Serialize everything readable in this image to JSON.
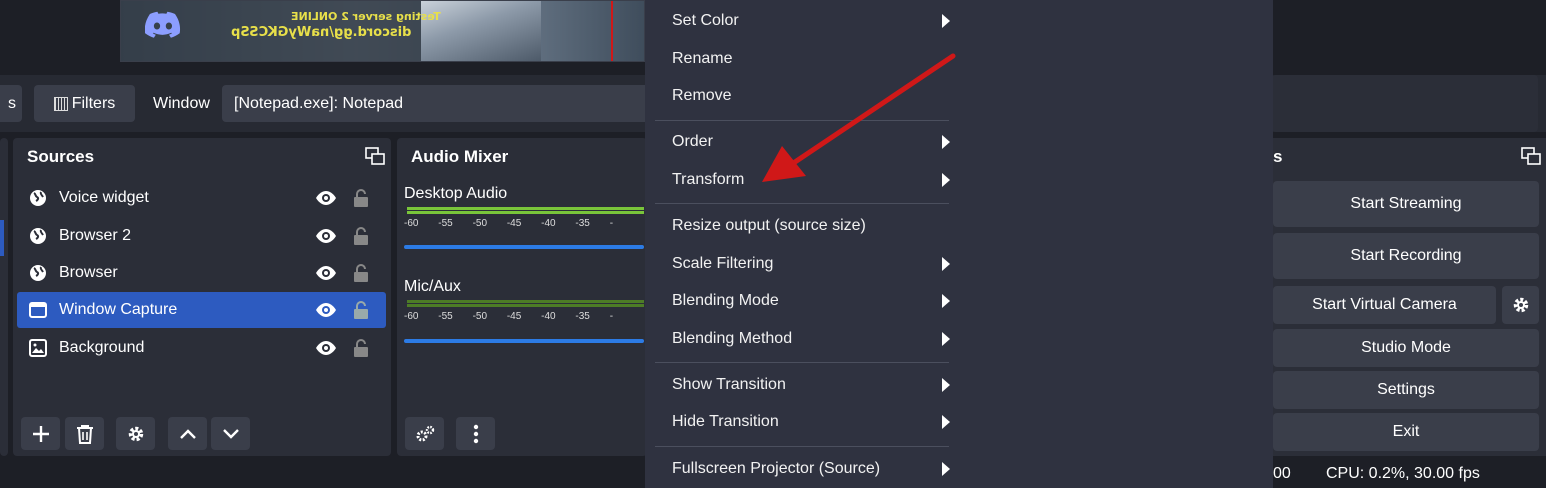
{
  "preview": {
    "overlay_line1": "Testing server 2 ONLINE",
    "overlay_line2": "discord.gg/naWyGKCSSp"
  },
  "context_bar": {
    "properties_stub": "s",
    "filters_label": "Filters",
    "window_label": "Window",
    "window_value": "[Notepad.exe]: Notepad"
  },
  "sources": {
    "title": "Sources",
    "items": [
      {
        "label": "Voice widget",
        "icon": "globe-icon"
      },
      {
        "label": "Browser 2",
        "icon": "globe-icon"
      },
      {
        "label": "Browser",
        "icon": "globe-icon"
      },
      {
        "label": "Window Capture",
        "icon": "window-icon",
        "selected": true
      },
      {
        "label": "Background",
        "icon": "image-icon"
      }
    ]
  },
  "mixer": {
    "title": "Audio Mixer",
    "channels": [
      {
        "label": "Desktop Audio"
      },
      {
        "label": "Mic/Aux"
      }
    ],
    "ticks": [
      "-60",
      "-55",
      "-50",
      "-45",
      "-40",
      "-35",
      "-"
    ]
  },
  "menu": {
    "items": [
      {
        "label": "Set Color",
        "submenu": true
      },
      {
        "label": "Rename",
        "submenu": false
      },
      {
        "label": "Remove",
        "submenu": false
      },
      {
        "label": "Order",
        "submenu": true
      },
      {
        "label": "Transform",
        "submenu": true
      },
      {
        "label": "Resize output (source size)",
        "submenu": false
      },
      {
        "label": "Scale Filtering",
        "submenu": true
      },
      {
        "label": "Blending Mode",
        "submenu": true
      },
      {
        "label": "Blending Method",
        "submenu": true
      },
      {
        "label": "Show Transition",
        "submenu": true
      },
      {
        "label": "Hide Transition",
        "submenu": true
      },
      {
        "label": "Fullscreen Projector (Source)",
        "submenu": true
      }
    ]
  },
  "controls": {
    "title_stub": "s",
    "start_streaming": "Start Streaming",
    "start_recording": "Start Recording",
    "start_virtual_camera": "Start Virtual Camera",
    "studio_mode": "Studio Mode",
    "settings": "Settings",
    "exit": "Exit"
  },
  "status": {
    "time_stub": "00",
    "cpu": "CPU: 0.2%, 30.00 fps"
  },
  "colors": {
    "selection": "#2d5bc0",
    "annotation_arrow": "#d01818",
    "meter_green": "#79c53a",
    "volume_blue": "#2c7be5"
  }
}
